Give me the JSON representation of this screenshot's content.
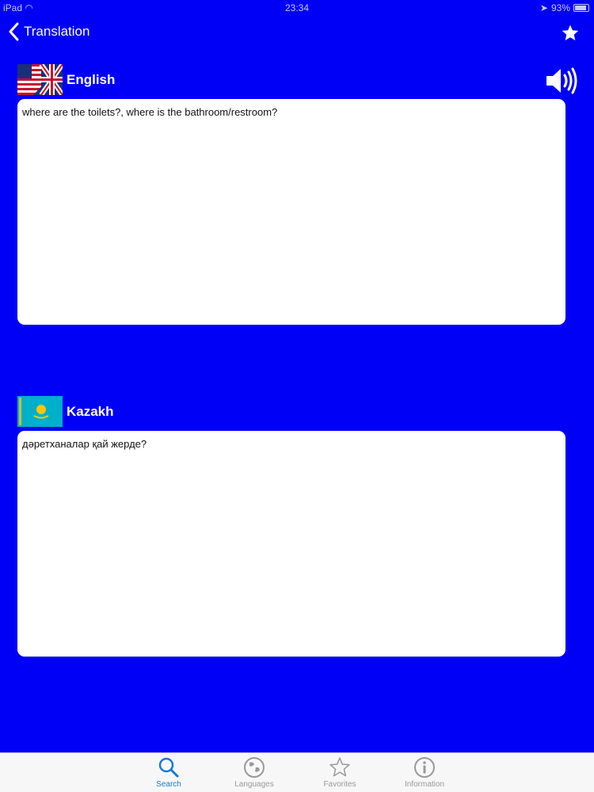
{
  "status_bar": {
    "device": "iPad",
    "time": "23:34",
    "battery": "93%"
  },
  "nav": {
    "back_label": "Translation",
    "favorite_icon": "star-icon"
  },
  "source": {
    "language": "English",
    "text": "where are the toilets?, where is the bathroom/restroom?"
  },
  "target": {
    "language": "Kazakh",
    "text": "дəретханалар қай жерде?"
  },
  "tabs": [
    {
      "label": "Search",
      "icon": "search-icon",
      "active": true
    },
    {
      "label": "Languages",
      "icon": "globe-icon",
      "active": false
    },
    {
      "label": "Favorites",
      "icon": "star-icon",
      "active": false
    },
    {
      "label": "Information",
      "icon": "info-icon",
      "active": false
    }
  ],
  "colors": {
    "background": "#0000f7",
    "accent": "#1a78d8"
  }
}
